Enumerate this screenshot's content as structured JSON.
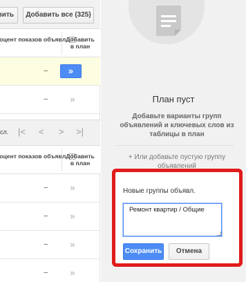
{
  "toolbar": {
    "partial_button_label": "вить",
    "add_all_button_label": "Добавить все (325)"
  },
  "table_top": {
    "col_percent": "роцент показов объявл.",
    "col_percent_help": "?",
    "col_add": "Добавить в план",
    "rows": [
      {
        "percent": "–",
        "add": "»",
        "highlighted": true
      },
      {
        "percent": "–",
        "add": "»",
        "highlighted": false
      }
    ]
  },
  "pager": {
    "label": "сл.",
    "first": "|<",
    "prev": "<",
    "next": ">",
    "last": ">|"
  },
  "table_bottom": {
    "col_percent": "роцент показов объявл.",
    "col_percent_help": "?",
    "col_add": "Добавить в план",
    "rows": [
      {
        "percent": "–",
        "add": "»"
      },
      {
        "percent": "–",
        "add": "»"
      },
      {
        "percent": "–",
        "add": "»"
      },
      {
        "percent": "–",
        "add": "»"
      }
    ]
  },
  "plan": {
    "empty_title": "План пуст",
    "empty_description": "Добавьте варианты групп объявлений и ключевых слов из таблицы в план",
    "add_empty_group": "+ Или добавьте пустую группу объявлений"
  },
  "popup": {
    "label": "Новые группы объявл.",
    "textarea_value": "Ремонт квартир / Общие",
    "save_label": "Сохранить",
    "cancel_label": "Отмена"
  },
  "colors": {
    "accent_blue": "#4d8cf5",
    "highlight_red": "#e01b1b"
  }
}
